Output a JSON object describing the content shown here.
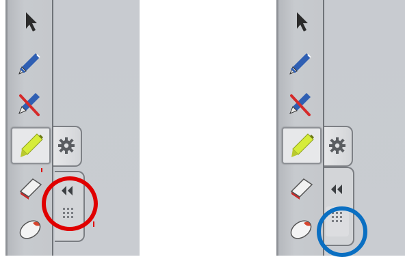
{
  "screenshots": [
    {
      "panel": "before",
      "tools": [
        {
          "icon": "arrow-cursor-icon",
          "selected": false
        },
        {
          "icon": "pen-icon",
          "selected": false
        },
        {
          "icon": "pen-erase-icon",
          "selected": false
        },
        {
          "icon": "highlighter-icon",
          "selected": true
        },
        {
          "icon": "eraser-icon",
          "selected": false
        },
        {
          "icon": "shape-icon",
          "selected": false
        }
      ],
      "settings_icon": "gear-icon",
      "collapse_icon": "double-chevron-left-icon",
      "grip_icon": "grip-dots-icon",
      "annotation_color": "#e00000"
    },
    {
      "panel": "after",
      "tools": [
        {
          "icon": "arrow-cursor-icon",
          "selected": false
        },
        {
          "icon": "pen-icon",
          "selected": false
        },
        {
          "icon": "pen-erase-icon",
          "selected": false
        },
        {
          "icon": "highlighter-icon",
          "selected": true
        },
        {
          "icon": "eraser-icon",
          "selected": false
        },
        {
          "icon": "shape-icon",
          "selected": false
        }
      ],
      "settings_icon": "gear-icon",
      "collapse_icon": "double-chevron-left-icon",
      "grip_icon": "grip-dots-icon",
      "annotation_color": "#0a6fc2"
    }
  ],
  "colors": {
    "panel_bg": "#c8cbd0",
    "highlighter": "#d6ec3a",
    "pen_blue": "#2f5fb3",
    "pen_red": "#d62a2a",
    "annotation_red": "#e00000",
    "annotation_blue": "#0a6fc2"
  }
}
